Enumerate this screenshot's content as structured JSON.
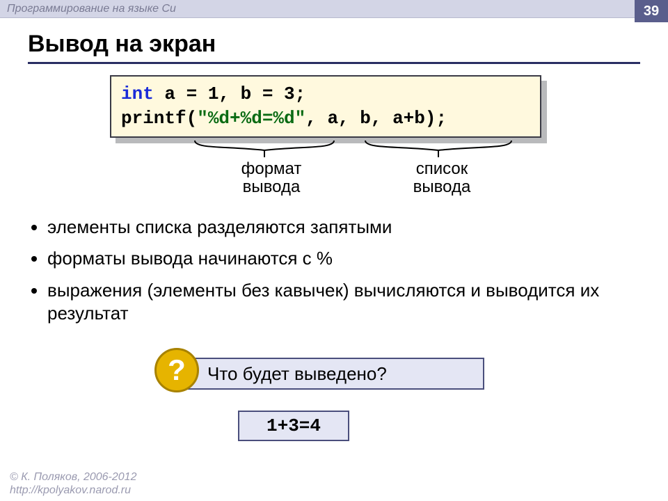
{
  "topbar": {
    "title": "Программирование на языке Си",
    "page_number": "39"
  },
  "heading": "Вывод на экран",
  "code": {
    "line1_kw": "int",
    "line1_rest": " a = 1, b = 3;",
    "line2_func": "printf(",
    "line2_str": "\"%d+%d=%d\"",
    "line2_args": ", a, b, a+b);"
  },
  "annotations": {
    "format": "формат\nвывода",
    "list": "список\nвывода"
  },
  "bullets": {
    "b1": "элементы списка разделяются запятыми",
    "b2": "форматы вывода начинаются с %",
    "b3": "выражения (элементы без кавычек) вычисляются и выводится их результат"
  },
  "question": {
    "mark": "?",
    "text": "Что будет выведено?"
  },
  "answer": "1+3=4",
  "footer": {
    "copy": "© К. Поляков, 2006-2012",
    "url": "http://kpolyakov.narod.ru"
  }
}
